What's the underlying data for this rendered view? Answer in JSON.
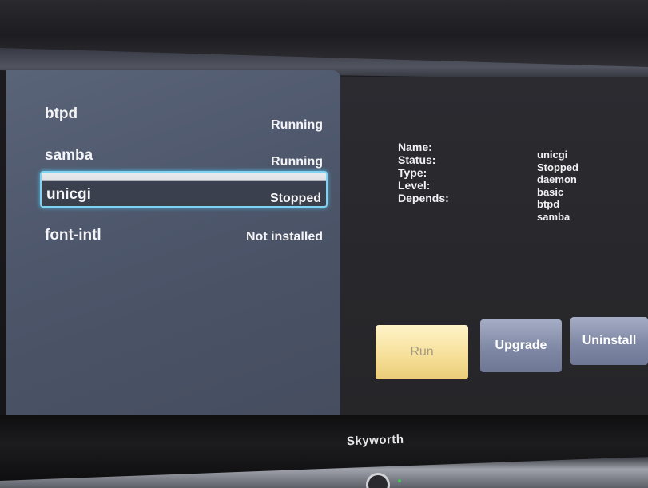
{
  "services": [
    {
      "name": "btpd",
      "status": "Running"
    },
    {
      "name": "samba",
      "status": "Running"
    },
    {
      "name": "unicgi",
      "status": "Stopped"
    },
    {
      "name": "font-intl",
      "status": "Not installed"
    }
  ],
  "selected_index": 2,
  "details": {
    "labels": {
      "name": "Name:",
      "status": "Status:",
      "type": "Type:",
      "level": "Level:",
      "depends": "Depends:"
    },
    "values": {
      "name": "unicgi",
      "status": "Stopped",
      "type": "daemon",
      "level": "basic",
      "depends": [
        "btpd",
        "samba"
      ]
    }
  },
  "buttons": {
    "run": "Run",
    "upgrade": "Upgrade",
    "uninstall": "Uninstall"
  },
  "brand": "Skyworth",
  "colors": {
    "selection_border": "#7fd3f0",
    "run_button": "#f5de96",
    "action_button": "#7f88a4",
    "left_panel": "#4d566a"
  }
}
